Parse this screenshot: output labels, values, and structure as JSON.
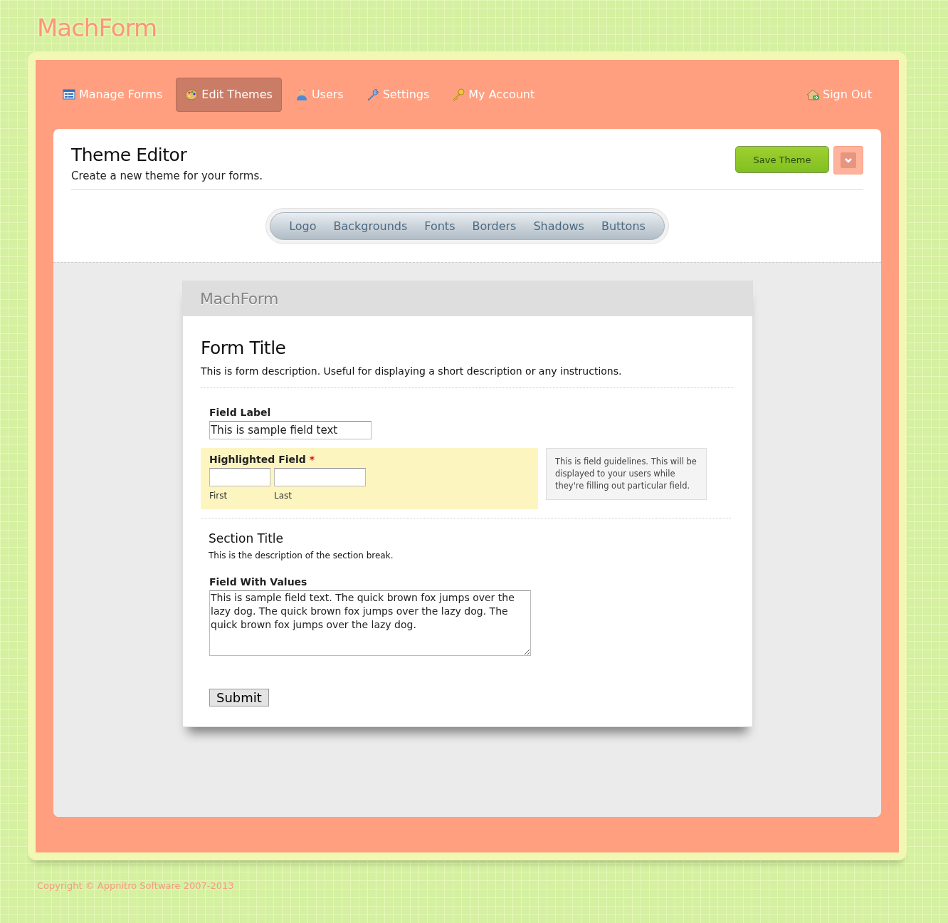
{
  "logo": "MachForm",
  "nav": [
    {
      "label": "Manage Forms",
      "selected": false
    },
    {
      "label": "Edit Themes",
      "selected": true
    },
    {
      "label": "Users",
      "selected": false
    },
    {
      "label": "Settings",
      "selected": false
    },
    {
      "label": "My Account",
      "selected": false
    }
  ],
  "sign_out": "Sign Out",
  "header": {
    "title": "Theme Editor",
    "subtitle": "Create a new theme for your forms."
  },
  "save_button": "Save Theme",
  "tabs": [
    "Logo",
    "Backgrounds",
    "Fonts",
    "Borders",
    "Shadows",
    "Buttons"
  ],
  "preview": {
    "logo": "MachForm",
    "title": "Form Title",
    "description": "This is form description. Useful for displaying a short description or any instructions.",
    "fields": [
      {
        "kind": "text",
        "label": "Field Label",
        "value": "This is sample field text"
      },
      {
        "kind": "name",
        "label": "Highlighted Field",
        "required_mark": "*",
        "highlighted": true,
        "sublabels": [
          "First",
          "Last"
        ],
        "guidelines": "This is field guidelines. This will be displayed to your users while they're filling out particular field."
      },
      {
        "kind": "section",
        "title": "Section Title",
        "description": "This is the description of the section break."
      },
      {
        "kind": "textarea",
        "label": "Field With Values",
        "value": "This is sample field text. The quick brown fox jumps over the lazy dog. The quick brown fox jumps over the lazy dog. The quick brown fox jumps over the lazy dog."
      }
    ],
    "submit": "Submit"
  },
  "footer": "Copyright © Appnitro Software 2007-2013"
}
